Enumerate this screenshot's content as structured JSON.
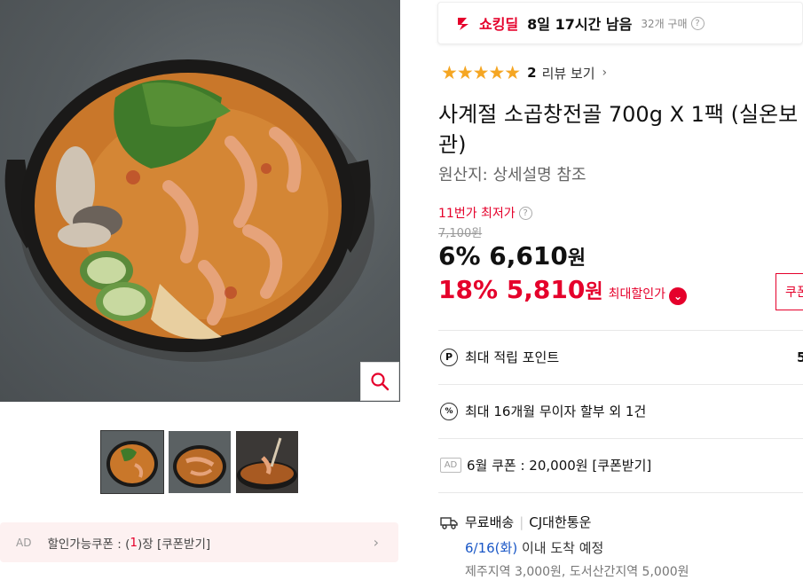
{
  "gallery": {
    "thumbnails": [
      {
        "label": "thumb-1",
        "active": true
      },
      {
        "label": "thumb-2",
        "active": false
      },
      {
        "label": "thumb-3",
        "active": false
      }
    ],
    "coupon_bar": {
      "ad": "AD",
      "text_before": "할인가능쿠폰 : (",
      "count": "1",
      "text_after": ")장 [쿠폰받기]"
    }
  },
  "deal": {
    "name": "쇼킹딜",
    "time_left": "8일 17시간 남음",
    "sold": "32개 구매",
    "help": "?"
  },
  "rating": {
    "stars": 5,
    "star_glyphs": "★★★★★",
    "review_count": "2",
    "review_link": "리뷰 보기",
    "chevron": "›"
  },
  "product": {
    "title": "사계절 소곱창전골 700g X 1팩 (실온보관)",
    "origin": "원산지: 상세설명 참조"
  },
  "price": {
    "lowest_label": "11번가 최저가",
    "original": "7,100원",
    "discount1": "6% 6,610",
    "won1": "원",
    "discount2": "18% 5,810",
    "won2": "원",
    "max_discount_label": "최대할인가",
    "coupon_button": "쿠폰"
  },
  "benefits": {
    "points_label": "최대 적립 포인트",
    "points_value": "5",
    "installment": "최대 16개월 무이자 할부 외 1건",
    "ad_tag": "AD",
    "coupon": "6월 쿠폰 : 20,000원 [쿠폰받기]"
  },
  "shipping": {
    "free": "무료배송",
    "carrier": "CJ대한통운",
    "arrive_date": "6/16(화)",
    "arrive_text": " 이내 도착 예정",
    "extra": "제주지역 3,000원, 도서산간지역 5,000원"
  },
  "colors": {
    "accent_red": "#e5002b",
    "star": "#f5a623",
    "link_blue": "#1a57c6"
  }
}
